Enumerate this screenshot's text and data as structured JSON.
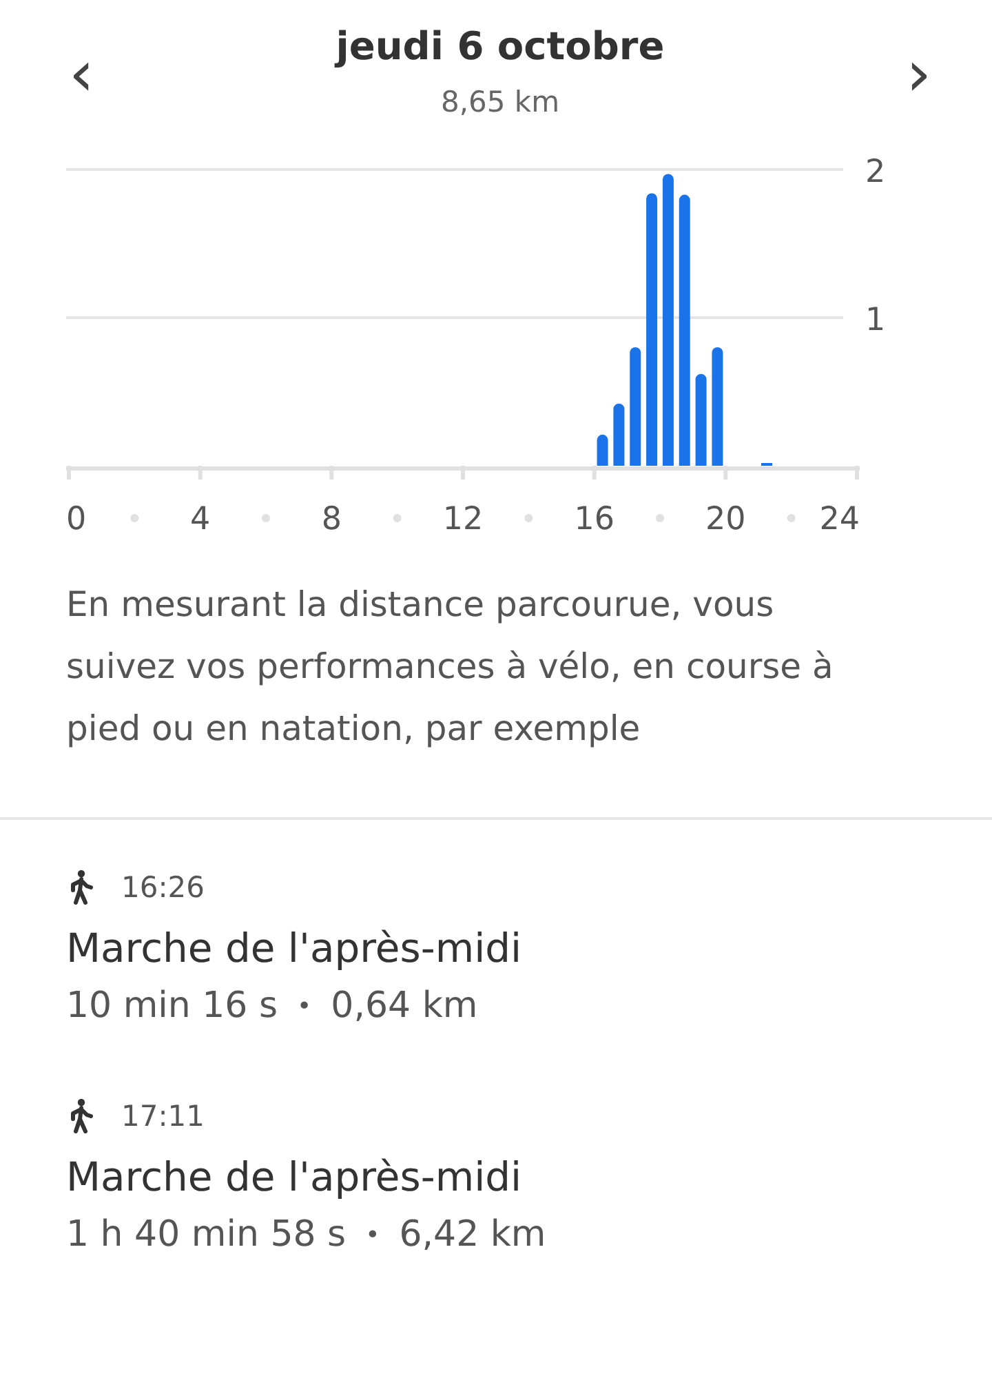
{
  "header": {
    "title": "jeudi 6 octobre",
    "subtitle": "8,65 km",
    "prev_button": "‹",
    "next_button": "›"
  },
  "chart_data": {
    "type": "bar",
    "x": [
      16.25,
      16.75,
      17.25,
      17.75,
      18.25,
      18.75,
      19.25,
      19.75,
      21.25
    ],
    "values": [
      0.21,
      0.42,
      0.8,
      1.84,
      1.97,
      1.83,
      0.62,
      0.8,
      0.02
    ],
    "xlim": [
      0,
      24
    ],
    "ylim": [
      0,
      2
    ],
    "xticks": [
      0,
      4,
      8,
      12,
      16,
      20,
      24
    ],
    "yticks": [
      1,
      2
    ]
  },
  "description": "En mesurant la distance parcourue, vous suivez vos performances à vélo, en course à pied ou en natation, par exemple",
  "activities": [
    {
      "kind": "walk",
      "time": "16:26",
      "title": "Marche de l'après-midi",
      "duration": "10 min 16 s",
      "separator": "•",
      "distance": "0,64 km"
    },
    {
      "kind": "walk",
      "time": "17:11",
      "title": "Marche de l'après-midi",
      "duration": "1 h 40 min 58 s",
      "separator": "•",
      "distance": "6,42 km"
    }
  ]
}
